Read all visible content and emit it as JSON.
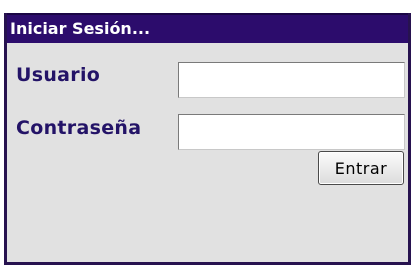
{
  "login": {
    "title": "Iniciar Sesión...",
    "username_label": "Usuario",
    "username_value": "",
    "password_label": "Contraseña",
    "password_value": "",
    "submit_label": "Entrar"
  },
  "colors": {
    "title_bar": "#2c0c6c",
    "label_text": "#231367",
    "panel_background": "#e1e1e1",
    "panel_border": "#27124f"
  }
}
